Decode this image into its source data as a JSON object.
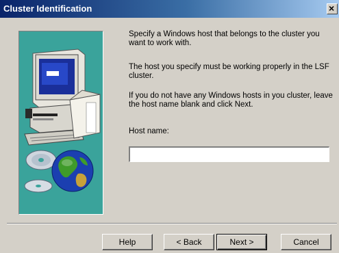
{
  "window": {
    "title": "Cluster Identification",
    "close_glyph": "×"
  },
  "content": {
    "paragraph1": "Specify a Windows host that belongs to the cluster you want to work with.",
    "paragraph2": "The host you specify must be working properly in the LSF cluster.",
    "paragraph3": "If you do not have any Windows hosts in you cluster, leave the host name blank and click Next.",
    "host_label": "Host name:",
    "host_value": ""
  },
  "buttons": {
    "help": "Help",
    "back": "< Back",
    "next": "Next >",
    "cancel": "Cancel"
  },
  "colors": {
    "titlebar_start": "#0a246a",
    "titlebar_end": "#a6caf0",
    "dialog_face": "#d4d0c8",
    "art_background": "#3aa39b"
  },
  "icons": [
    "close-icon",
    "computer-icon",
    "cd-disc-icon",
    "globe-icon"
  ]
}
